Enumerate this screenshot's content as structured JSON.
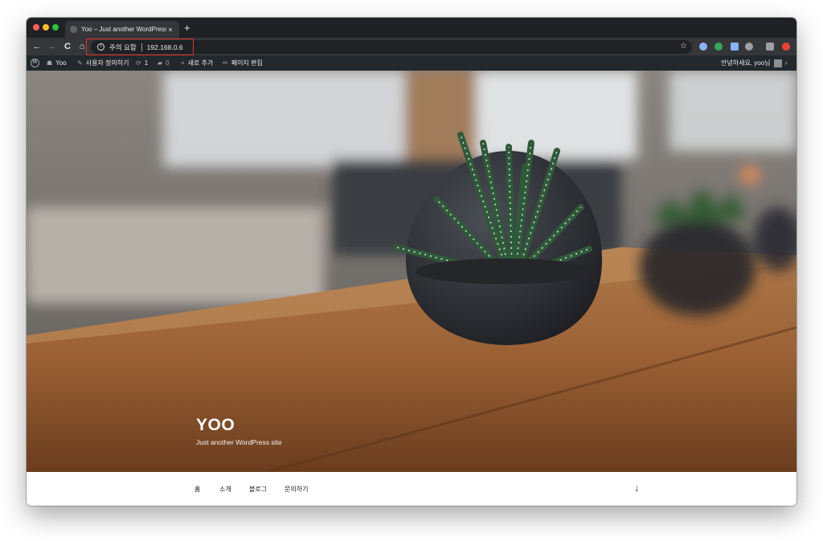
{
  "browser": {
    "tab": {
      "title": "Yoo – Just another WordPress si",
      "close": "×",
      "favicon": "wordpress-favicon"
    },
    "new_tab": "+",
    "nav": {
      "back": "←",
      "forward": "→",
      "reload": "C",
      "home": "⌂"
    },
    "address": {
      "security_label": "주의 요함",
      "url": "192.168.0.6",
      "info_icon": "ⓘ",
      "bookmark_star": "☆"
    },
    "extension_colors": [
      "#8ab4f8",
      "#34a853",
      "#8ab4f8",
      "#9aa0a6",
      "#9aa0a6",
      "#ea4335"
    ]
  },
  "adminbar": {
    "site_name": "Yoo",
    "customize": "사용자 정의하기",
    "updates_count": "1",
    "comments_count": "0",
    "new_content": "새로 추가",
    "edit_page": "페이지 편집",
    "greeting": "안녕하세요, yoo님"
  },
  "hero": {
    "title": "YOO",
    "tagline": "Just another WordPress site"
  },
  "nav": {
    "items": [
      "홈",
      "소개",
      "블로그",
      "문의하기"
    ],
    "scroll_arrow": "↓"
  },
  "colors": {
    "accent_highlight": "#e0332b",
    "adminbar_bg": "#23282d",
    "tab_bg": "#35363a"
  }
}
